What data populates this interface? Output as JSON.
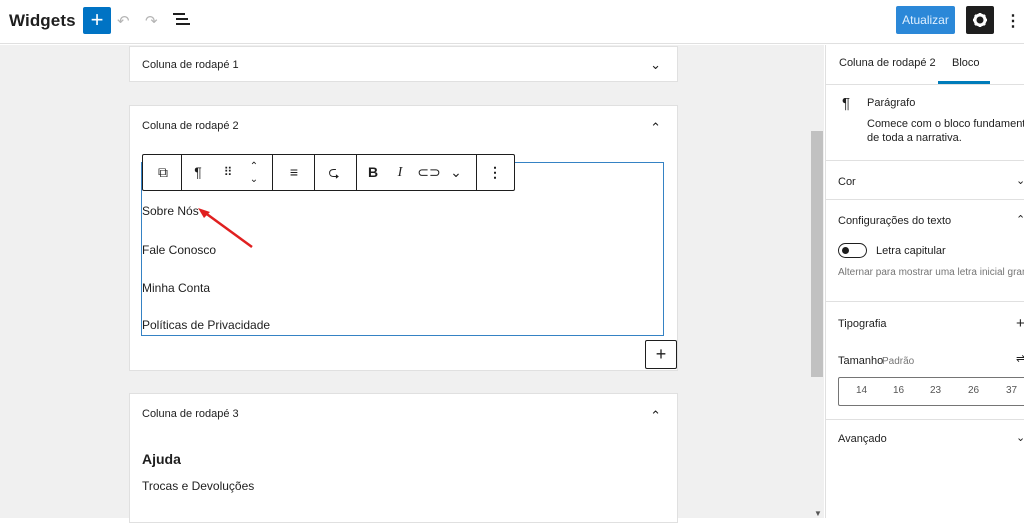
{
  "header": {
    "title": "Widgets",
    "update_label": "Atualizar"
  },
  "widget_areas": [
    {
      "title": "Coluna de rodapé 1",
      "expanded": false
    },
    {
      "title": "Coluna de rodapé 2",
      "expanded": true
    },
    {
      "title": "Coluna de rodapé 3",
      "expanded": true
    }
  ],
  "paragraphs": [
    "Sobre Nós",
    "Fale Conosco",
    "Minha Conta",
    "Políticas de Privacidade"
  ],
  "area3": {
    "heading": "Ajuda",
    "text": "Trocas e Devoluções"
  },
  "sidebar": {
    "tabs": [
      "Coluna de rodapé 2",
      "Bloco"
    ],
    "block_name": "Parágrafo",
    "block_desc_1": "Comece com o bloco fundamental",
    "block_desc_2": "de toda a narrativa.",
    "color_label": "Cor",
    "text_settings_label": "Configurações do texto",
    "drop_cap_label": "Letra capitular",
    "drop_cap_help": "Alternar para mostrar uma letra inicial grande.",
    "typography_label": "Tipografia",
    "size_label": "Tamanho",
    "size_value": "Padrão",
    "sizes": [
      "14",
      "16",
      "23",
      "26",
      "37"
    ],
    "advanced_label": "Avançado"
  },
  "colors": {
    "accent": "#007cba",
    "button": "#0073c4",
    "selection_border": "#3582c4",
    "arrow": "#e02020"
  }
}
